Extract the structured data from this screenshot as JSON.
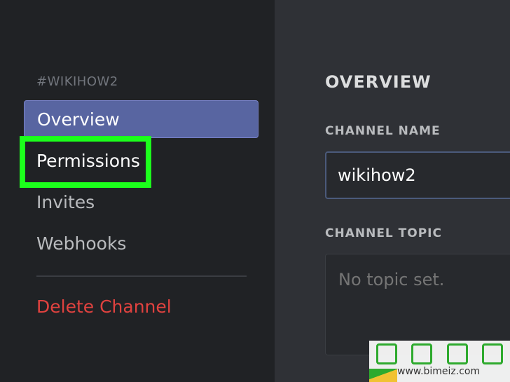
{
  "sidebar": {
    "header": "#WIKIHOW2",
    "items": [
      {
        "label": "Overview"
      },
      {
        "label": "Permissions"
      },
      {
        "label": "Invites"
      },
      {
        "label": "Webhooks"
      }
    ],
    "delete_label": "Delete Channel"
  },
  "main": {
    "section_title": "OVERVIEW",
    "channel_name_label": "CHANNEL NAME",
    "channel_name_value": "wikihow2",
    "channel_topic_label": "CHANNEL TOPIC",
    "channel_topic_placeholder": "No topic set."
  },
  "watermark": {
    "url": "www.bimeiz.com"
  },
  "colors": {
    "selected_bg": "#5865a1",
    "highlight": "#1cff1c",
    "danger": "#e0423f"
  }
}
